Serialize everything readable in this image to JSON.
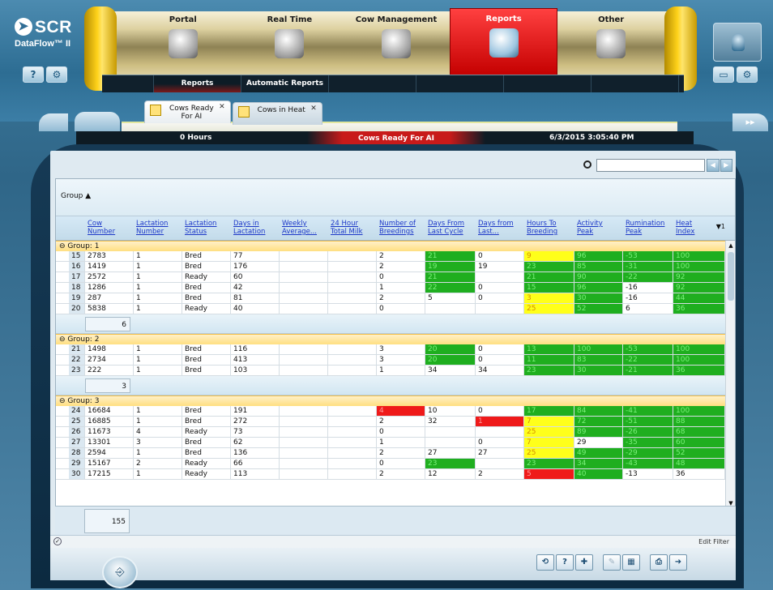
{
  "brand": {
    "logo": "SCR",
    "product": "DataFlow™ II"
  },
  "modules": [
    {
      "label": "Portal",
      "icon": "barn-icon",
      "active": false
    },
    {
      "label": "Real Time",
      "icon": "milk-tank-icon",
      "active": false
    },
    {
      "label": "Cow Management",
      "icon": "clipboard-icon",
      "active": false
    },
    {
      "label": "Reports",
      "icon": "reports-icon",
      "active": true
    },
    {
      "label": "Other",
      "icon": "box-icon",
      "active": false
    }
  ],
  "subnav": [
    {
      "label": "Reports",
      "active": true
    },
    {
      "label": "Automatic Reports",
      "active": false
    }
  ],
  "tabs": [
    {
      "label": "Cows Ready\nFor AI",
      "active": true
    },
    {
      "label": "Cows in Heat",
      "active": false
    }
  ],
  "status": {
    "hours": "0 Hours",
    "title": "Cows Ready For AI",
    "datetime": "6/3/2015 3:05:40 PM"
  },
  "search": {
    "placeholder": ""
  },
  "grouping": {
    "label": "Group",
    "sort_icon": "▲"
  },
  "columns": [
    "Cow\nNumber",
    "Lactation\nNumber",
    "Lactation\nStatus",
    "Days in\nLactation",
    "Weekly\nAverage...",
    "24 Hour\nTotal Milk",
    "Number of\nBreedings",
    "Days From\nLast Cycle",
    "Days from\nLast...",
    "Hours To\nBreeding",
    "Activity\nPeak",
    "Rumination\nPeak",
    "Heat\nIndex"
  ],
  "sort_hint": "▼1",
  "groups": [
    {
      "label": "Group: 1",
      "count": "6",
      "rows": [
        [
          "15",
          "2783",
          "1",
          "Bred",
          "77",
          "",
          "",
          "2",
          "21",
          "0",
          "9",
          "96",
          "-53",
          "100"
        ],
        [
          "16",
          "1419",
          "1",
          "Bred",
          "176",
          "",
          "",
          "2",
          "19",
          "19",
          "23",
          "85",
          "-31",
          "100"
        ],
        [
          "17",
          "2572",
          "1",
          "Ready",
          "60",
          "",
          "",
          "0",
          "21",
          "",
          "21",
          "90",
          "-22",
          "92"
        ],
        [
          "18",
          "1286",
          "1",
          "Bred",
          "42",
          "",
          "",
          "1",
          "22",
          "0",
          "15",
          "96",
          "-16",
          "92"
        ],
        [
          "19",
          "287",
          "1",
          "Bred",
          "81",
          "",
          "",
          "2",
          "5",
          "0",
          "3",
          "30",
          "-16",
          "44"
        ],
        [
          "20",
          "5838",
          "1",
          "Ready",
          "40",
          "",
          "",
          "0",
          "",
          "",
          "25",
          "52",
          "6",
          "36"
        ]
      ],
      "colors": [
        [
          "",
          "",
          "",
          "",
          "",
          "",
          "",
          "",
          "g",
          "",
          "y",
          "g",
          "g",
          "g"
        ],
        [
          "",
          "",
          "",
          "",
          "",
          "",
          "",
          "",
          "g",
          "",
          "g",
          "g",
          "g",
          "g"
        ],
        [
          "",
          "",
          "",
          "",
          "",
          "",
          "",
          "",
          "g",
          "",
          "g",
          "g",
          "g",
          "g"
        ],
        [
          "",
          "",
          "",
          "",
          "",
          "",
          "",
          "",
          "g",
          "",
          "g",
          "g",
          "",
          "g"
        ],
        [
          "",
          "",
          "",
          "",
          "",
          "",
          "",
          "",
          "",
          "",
          "y",
          "g",
          "",
          "g"
        ],
        [
          "",
          "",
          "",
          "",
          "",
          "",
          "",
          "",
          "",
          "",
          "y",
          "g",
          "",
          "g"
        ]
      ]
    },
    {
      "label": "Group: 2",
      "count": "3",
      "rows": [
        [
          "21",
          "1498",
          "1",
          "Bred",
          "116",
          "",
          "",
          "3",
          "20",
          "0",
          "13",
          "100",
          "-53",
          "100"
        ],
        [
          "22",
          "2734",
          "1",
          "Bred",
          "413",
          "",
          "",
          "3",
          "20",
          "0",
          "11",
          "83",
          "-22",
          "100"
        ],
        [
          "23",
          "222",
          "1",
          "Bred",
          "103",
          "",
          "",
          "1",
          "34",
          "34",
          "23",
          "30",
          "-21",
          "36"
        ]
      ],
      "colors": [
        [
          "",
          "",
          "",
          "",
          "",
          "",
          "",
          "",
          "g",
          "",
          "g",
          "g",
          "g",
          "g"
        ],
        [
          "",
          "",
          "",
          "",
          "",
          "",
          "",
          "",
          "g",
          "",
          "g",
          "g",
          "g",
          "g"
        ],
        [
          "",
          "",
          "",
          "",
          "",
          "",
          "",
          "",
          "",
          "",
          "g",
          "g",
          "g",
          "g"
        ]
      ]
    },
    {
      "label": "Group: 3",
      "count": "",
      "rows": [
        [
          "24",
          "16684",
          "1",
          "Bred",
          "191",
          "",
          "",
          "4",
          "10",
          "0",
          "17",
          "84",
          "-41",
          "100"
        ],
        [
          "25",
          "16885",
          "1",
          "Bred",
          "272",
          "",
          "",
          "2",
          "32",
          "1",
          "7",
          "72",
          "-51",
          "88"
        ],
        [
          "26",
          "11673",
          "4",
          "Ready",
          "73",
          "",
          "",
          "0",
          "",
          "",
          "25",
          "89",
          "-26",
          "68"
        ],
        [
          "27",
          "13301",
          "3",
          "Bred",
          "62",
          "",
          "",
          "1",
          "",
          "0",
          "7",
          "29",
          "-35",
          "60"
        ],
        [
          "28",
          "2594",
          "1",
          "Bred",
          "136",
          "",
          "",
          "2",
          "27",
          "27",
          "25",
          "49",
          "-29",
          "52"
        ],
        [
          "29",
          "15167",
          "2",
          "Ready",
          "66",
          "",
          "",
          "0",
          "23",
          "",
          "23",
          "34",
          "-43",
          "48"
        ],
        [
          "30",
          "17215",
          "1",
          "Ready",
          "113",
          "",
          "",
          "2",
          "12",
          "2",
          "5",
          "40",
          "-13",
          "36"
        ]
      ],
      "colors": [
        [
          "",
          "",
          "",
          "",
          "",
          "",
          "",
          "r",
          "",
          "",
          "g",
          "g",
          "g",
          "g"
        ],
        [
          "",
          "",
          "",
          "",
          "",
          "",
          "",
          "",
          "",
          "r",
          "y",
          "g",
          "g",
          "g"
        ],
        [
          "",
          "",
          "",
          "",
          "",
          "",
          "",
          "",
          "",
          "",
          "y",
          "g",
          "g",
          "g"
        ],
        [
          "",
          "",
          "",
          "",
          "",
          "",
          "",
          "",
          "",
          "",
          "y",
          "",
          "g",
          "g"
        ],
        [
          "",
          "",
          "",
          "",
          "",
          "",
          "",
          "",
          "",
          "",
          "y",
          "g",
          "g",
          "g"
        ],
        [
          "",
          "",
          "",
          "",
          "",
          "",
          "",
          "",
          "g",
          "",
          "g",
          "g",
          "g",
          "g"
        ],
        [
          "",
          "",
          "",
          "",
          "",
          "",
          "",
          "",
          "",
          "",
          "r",
          "g",
          "",
          ""
        ]
      ]
    }
  ],
  "total": "155",
  "footer": {
    "edit_filter": "Edit Filter"
  },
  "toolbar": [
    {
      "name": "refresh-button",
      "glyph": "⟲"
    },
    {
      "name": "help-button",
      "glyph": "?"
    },
    {
      "name": "add-favorite-button",
      "glyph": "✚"
    },
    {
      "name": "edit-button",
      "glyph": "✎"
    },
    {
      "name": "calendar-button",
      "glyph": "▦"
    },
    {
      "name": "print-button",
      "glyph": "⎙"
    },
    {
      "name": "export-button",
      "glyph": "➜"
    }
  ]
}
